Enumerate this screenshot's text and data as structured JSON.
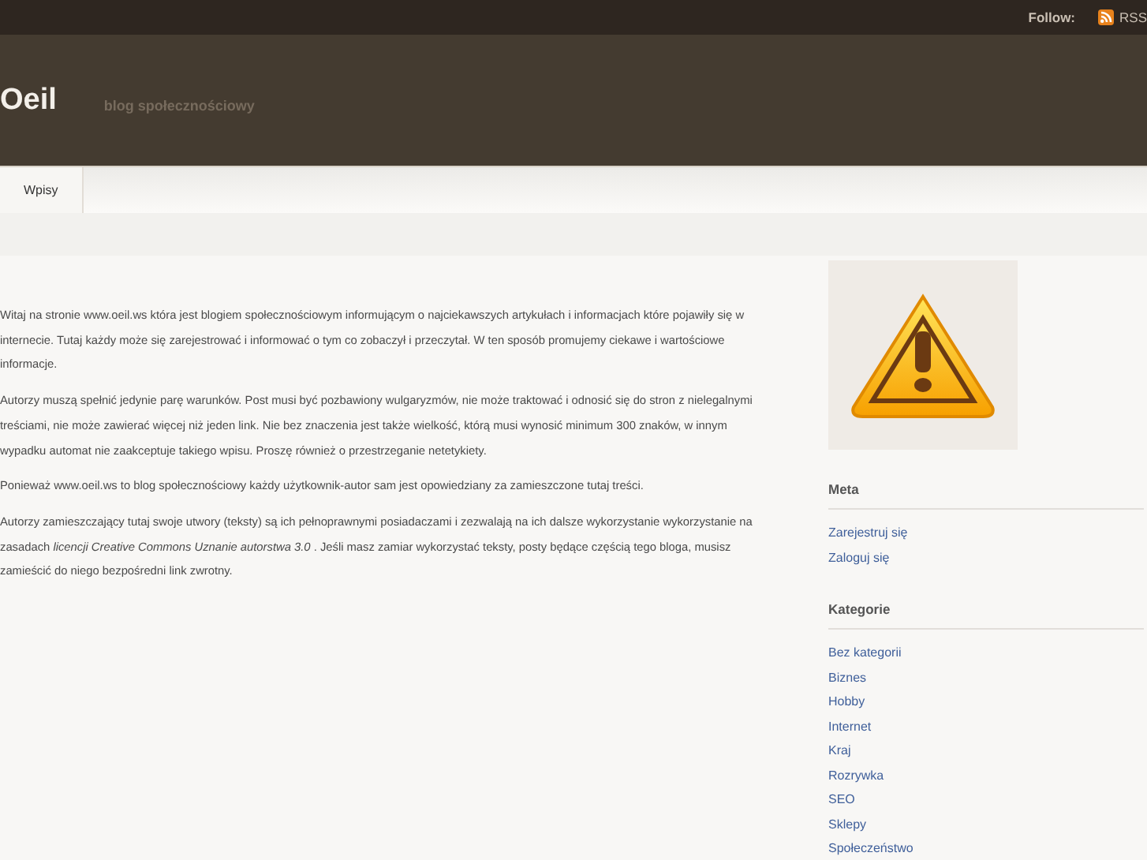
{
  "top_bar": {
    "follow_label": "Follow:",
    "rss_label": "RSS"
  },
  "header": {
    "title": "Oeil",
    "tagline": "blog społecznościowy"
  },
  "nav": {
    "tabs": [
      {
        "label": "Wpisy",
        "selected": true
      }
    ]
  },
  "content": {
    "paragraphs": [
      "Witaj na stronie www.oeil.ws która jest blogiem społecznościowym informującym o najciekawszych artykułach i informacjach które pojawiły się w internecie. Tutaj każdy może się zarejestrować i informować o tym co zobaczył i przeczytał. W ten sposób promujemy ciekawe i wartościowe informacje.",
      "Autorzy muszą spełnić jedynie parę warunków. Post musi być pozbawiony wulgaryzmów, nie może traktować i odnosić się do stron z nielegalnymi treściami, nie może zawierać więcej niż jeden link. Nie bez znaczenia jest także wielkość, którą musi wynosić minimum 300 znaków, w innym wypadku automat nie zaakceptuje takiego wpisu. Proszę również o przestrzeganie netetykiety.",
      "Ponieważ www.oeil.ws to blog społecznościowy każdy użytkownik-autor sam jest opowiedziany za zamieszczone tutaj treści.",
      "Autorzy zamieszczający tutaj swoje utwory (teksty) są ich pełnoprawnymi posiadaczami i zezwalają na ich dalsze wykorzystanie wykorzystanie na zasadach *licencji Creative Commons Uznanie autorstwa 3.0* . Jeśli masz zamiar wykorzystać teksty, posty będące częścią tego bloga, musisz zamieścić do niego bezpośredni link zwrotny."
    ]
  },
  "sidebar": {
    "widgets": [
      {
        "title": "Meta",
        "links": [
          "Zarejestruj się",
          "Zaloguj się"
        ]
      },
      {
        "title": "Kategorie",
        "links": [
          "Bez kategorii",
          "Biznes",
          "Hobby",
          "Internet",
          "Kraj",
          "Rozrywka",
          "SEO",
          "Sklepy",
          "Społeczeństwo"
        ]
      }
    ]
  }
}
